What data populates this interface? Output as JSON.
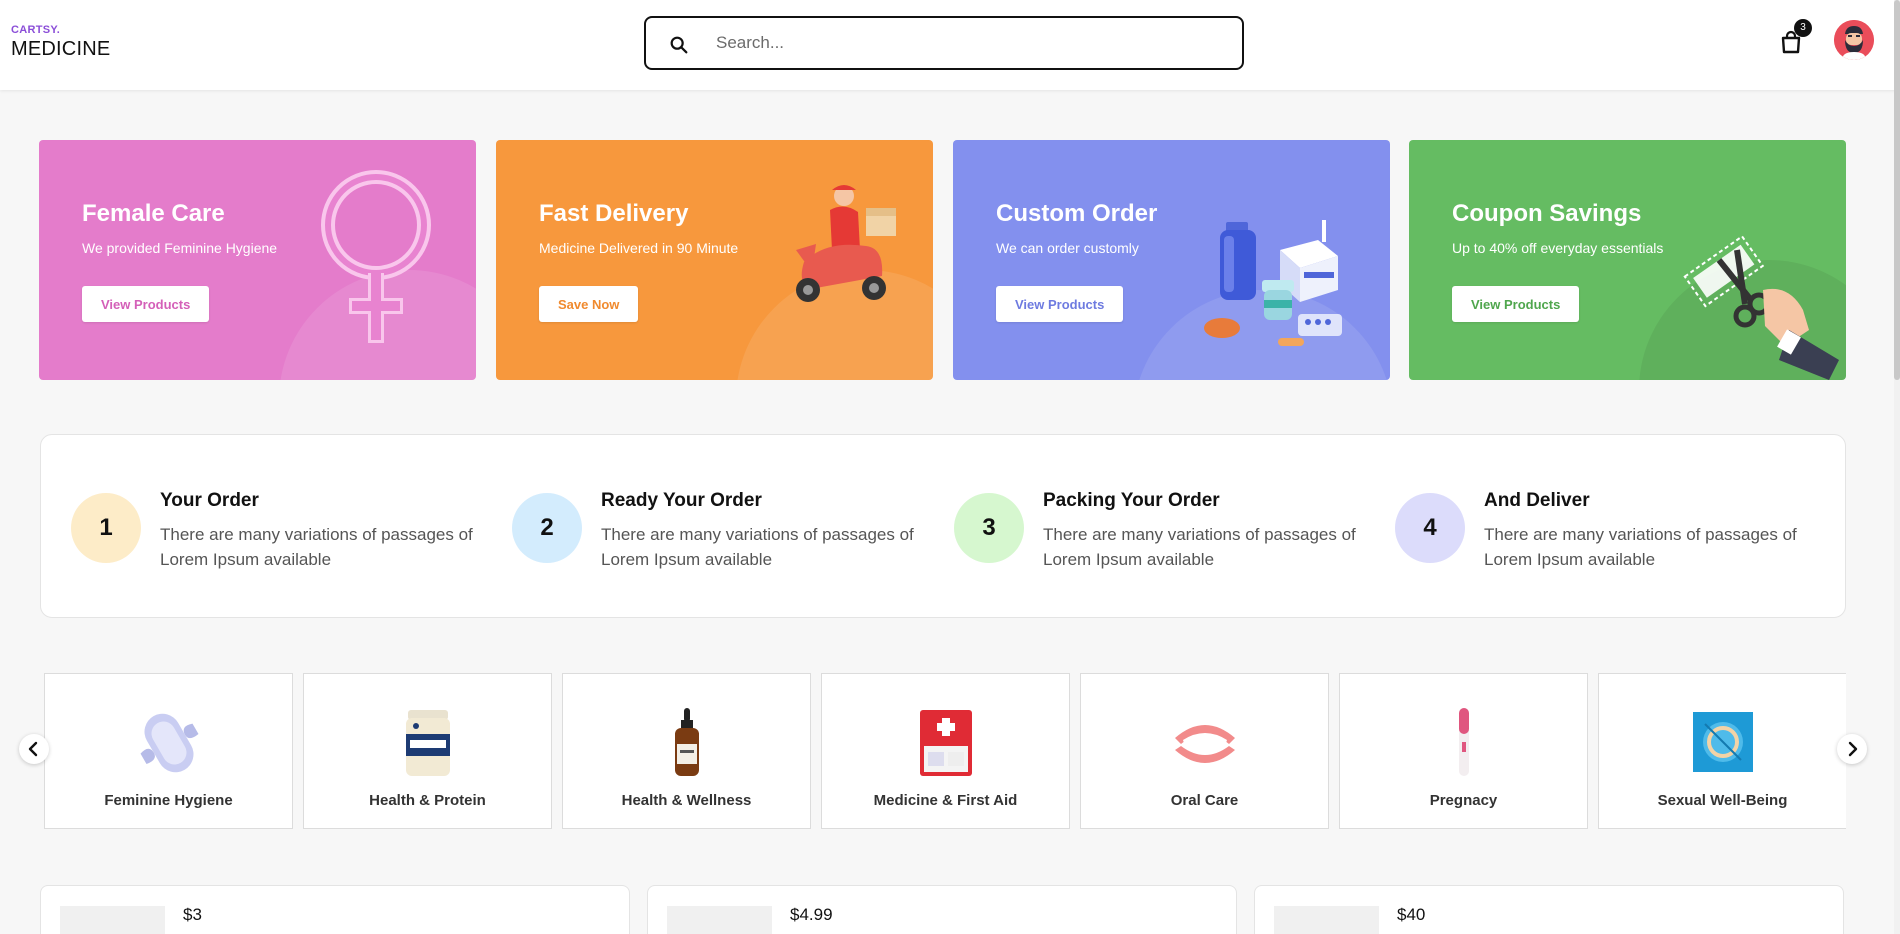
{
  "header": {
    "logo_top": "CARTSY.",
    "logo_bottom": "MEDICINE",
    "search_placeholder": "Search...",
    "cart_count": "3",
    "icons": [
      "search-icon",
      "shopping-bag-icon",
      "avatar"
    ]
  },
  "promos": [
    {
      "title": "Female Care",
      "subtitle": "We provided Feminine Hygiene",
      "button": "View Products",
      "color": "#e47ccb",
      "button_color": "#d45fb8"
    },
    {
      "title": "Fast Delivery",
      "subtitle": "Medicine Delivered in 90 Minute",
      "button": "Save Now",
      "color": "#f7983d",
      "button_color": "#f08a2e"
    },
    {
      "title": "Custom Order",
      "subtitle": "We can order customly",
      "button": "View Products",
      "color": "#8390ee",
      "button_color": "#6e7be0"
    },
    {
      "title": "Coupon Savings",
      "subtitle": "Up to 40% off everyday essentials",
      "button": "View Products",
      "color": "#65bc62",
      "button_color": "#4fa64d"
    }
  ],
  "steps": [
    {
      "num": "1",
      "title": "Your Order",
      "text": "There are many variations of passages of Lorem Ipsum available",
      "color": "#fdecc8"
    },
    {
      "num": "2",
      "title": "Ready Your Order",
      "text": "There are many variations of passages of Lorem Ipsum available",
      "color": "#d3ecfd"
    },
    {
      "num": "3",
      "title": "Packing Your Order",
      "text": "There are many variations of passages of Lorem Ipsum available",
      "color": "#d6f7cf"
    },
    {
      "num": "4",
      "title": "And Deliver",
      "text": "There are many variations of passages of Lorem Ipsum available",
      "color": "#dcdcfb"
    }
  ],
  "categories": [
    {
      "label": "Feminine Hygiene",
      "icon": "sanitary-pad-icon"
    },
    {
      "label": "Health & Protein",
      "icon": "protein-jar-icon"
    },
    {
      "label": "Health & Wellness",
      "icon": "dropper-bottle-icon"
    },
    {
      "label": "Medicine & First Aid",
      "icon": "first-aid-kit-icon"
    },
    {
      "label": "Oral Care",
      "icon": "dentures-icon"
    },
    {
      "label": "Pregnacy",
      "icon": "pregnancy-test-icon"
    },
    {
      "label": "Sexual Well-Being",
      "icon": "condom-pack-icon"
    }
  ],
  "products": [
    {
      "price": "$3"
    },
    {
      "price": "$4.99"
    },
    {
      "price": "$40"
    }
  ],
  "carousel": {
    "prev_icon": "chevron-left-icon",
    "next_icon": "chevron-right-icon"
  }
}
